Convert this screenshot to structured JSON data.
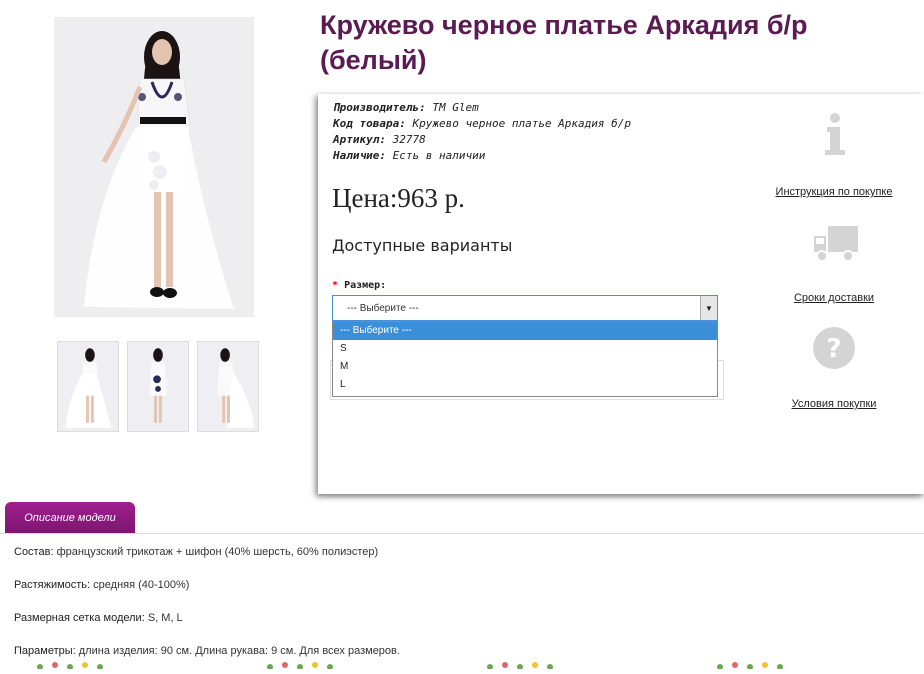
{
  "product": {
    "title": "Кружево черное платье Аркадия б/р (белый)",
    "manufacturer_label": "Производитель:",
    "manufacturer": "TM Glem",
    "code_label": "Код товара:",
    "code": "Кружево черное платье Аркадия б/р",
    "sku_label": "Артикул:",
    "sku": "32778",
    "stock_label": "Наличие:",
    "stock": "Есть в наличии",
    "price": "Цена:963 р."
  },
  "options": {
    "heading": "Доступные варианты",
    "size_required_mark": "*",
    "size_label": "Размер:",
    "selected": "--- Выберите ---",
    "items": [
      "--- Выберите ---",
      "S",
      "M",
      "L"
    ]
  },
  "side": {
    "instruction": "Инструкция по покупке",
    "delivery": "Сроки доставки",
    "terms": "Условия покупки",
    "icons": [
      "info-icon",
      "truck-icon",
      "question-icon"
    ]
  },
  "tabs": {
    "description": "Описание модели"
  },
  "description": {
    "composition_label": "Состав:",
    "composition": "французский трикотаж + шифон (40% шерсть, 60% полиэстер)",
    "stretch_label": "Растяжимость:",
    "stretch": "средняя (40-100%)",
    "sizes_label": "Размерная сетка модели:",
    "sizes": "S, M, L",
    "params_label": "Параметры:",
    "params": "длина изделия: 90 см. Длина рукава: 9 см. Для всех размеров."
  },
  "colors": {
    "title": "#5b1a52",
    "tab": "#8e1a7e",
    "highlight": "#3b8fd9",
    "icon_gray": "#d4d4d4"
  }
}
